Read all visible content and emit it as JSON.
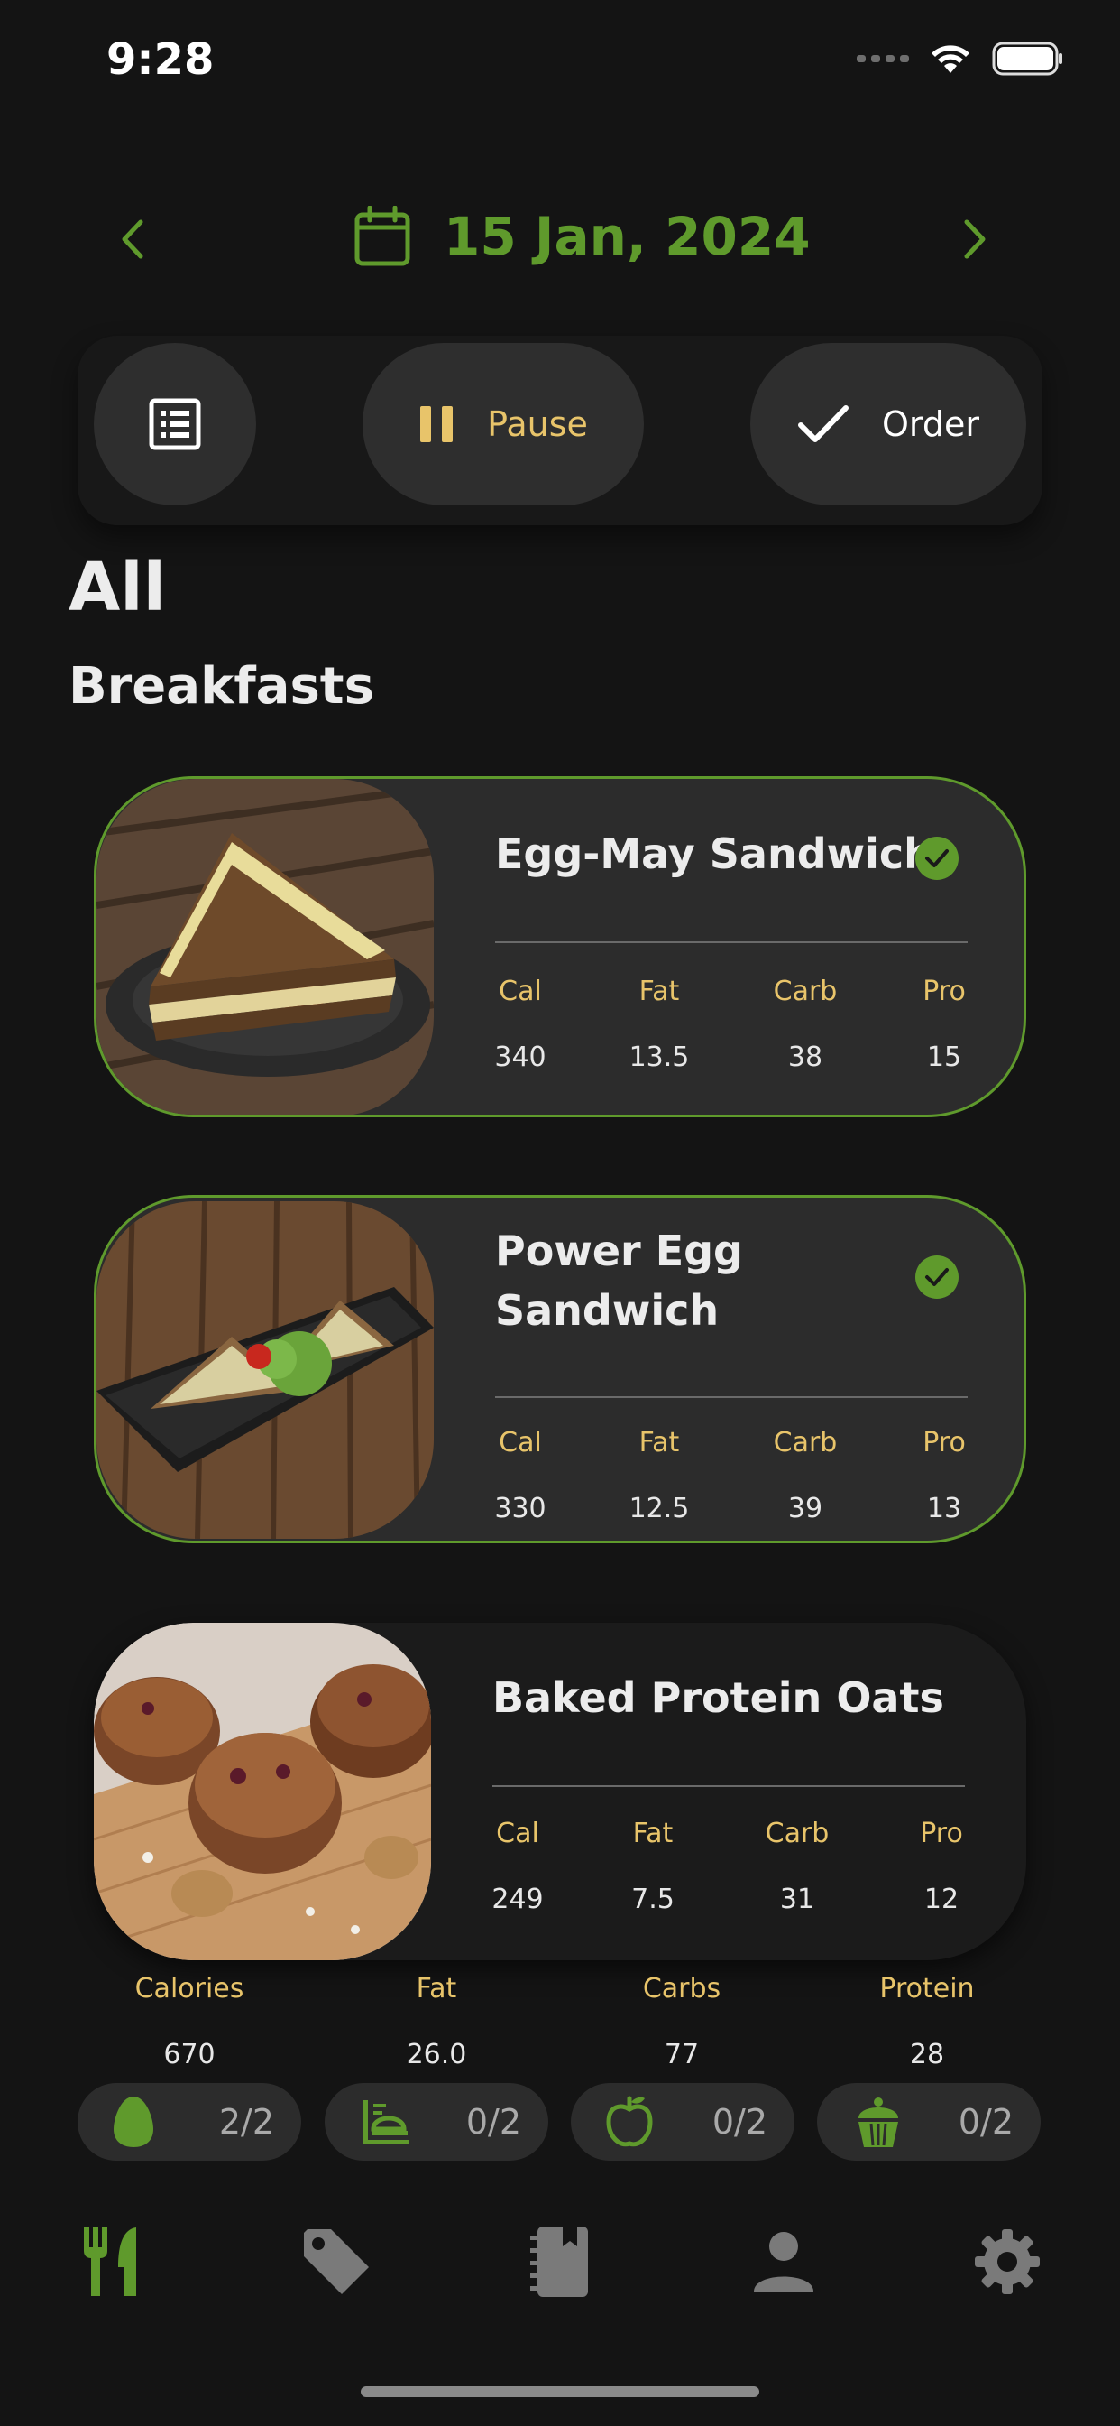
{
  "status_bar": {
    "time": "9:28"
  },
  "header": {
    "date": "15 Jan, 2024"
  },
  "actions": {
    "pause_label": "Pause",
    "order_label": "Order"
  },
  "headings": {
    "all": "All",
    "section": "Breakfasts"
  },
  "meals": [
    {
      "name_lines": [
        "Egg-May Sandwich"
      ],
      "selected": true,
      "macros": {
        "cal_label": "Cal",
        "fat_label": "Fat",
        "carb_label": "Carb",
        "pro_label": "Pro",
        "cal": "340",
        "fat": "13.5",
        "carb": "38",
        "pro": "15"
      }
    },
    {
      "name_lines": [
        "Power Egg",
        "Sandwich"
      ],
      "selected": true,
      "macros": {
        "cal_label": "Cal",
        "fat_label": "Fat",
        "carb_label": "Carb",
        "pro_label": "Pro",
        "cal": "330",
        "fat": "12.5",
        "carb": "39",
        "pro": "13"
      }
    },
    {
      "name_lines": [
        "Baked Protein Oats"
      ],
      "selected": false,
      "macros": {
        "cal_label": "Cal",
        "fat_label": "Fat",
        "carb_label": "Carb",
        "pro_label": "Pro",
        "cal": "249",
        "fat": "7.5",
        "carb": "31",
        "pro": "12"
      }
    }
  ],
  "totals": {
    "calories_label": "Calories",
    "calories": "670",
    "fat_label": "Fat",
    "fat": "26.0",
    "carbs_label": "Carbs",
    "carbs": "77",
    "protein_label": "Protein",
    "protein": "28"
  },
  "meal_counters": [
    {
      "icon": "egg-icon",
      "count": "2/2"
    },
    {
      "icon": "lunch-tray-icon",
      "count": "0/2"
    },
    {
      "icon": "apple-icon",
      "count": "0/2"
    },
    {
      "icon": "cupcake-icon",
      "count": "0/2"
    }
  ],
  "bottom_nav": [
    {
      "icon": "fork-knife-icon",
      "active": true
    },
    {
      "icon": "tag-icon",
      "active": false
    },
    {
      "icon": "notebook-icon",
      "active": false
    },
    {
      "icon": "person-icon",
      "active": false
    },
    {
      "icon": "gear-icon",
      "active": false
    }
  ],
  "colors": {
    "accent": "#5f9a2c",
    "gold": "#e8c46a",
    "background": "#141414",
    "card": "#2c2c2c"
  }
}
